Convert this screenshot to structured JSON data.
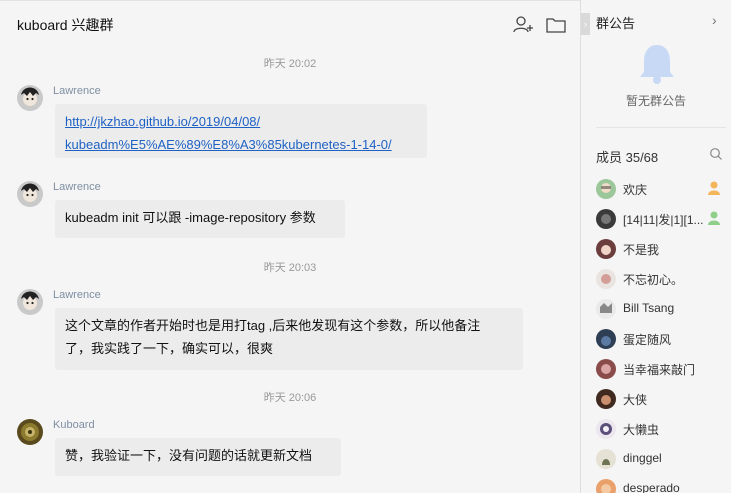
{
  "chat": {
    "title": "kuboard 兴趣群",
    "messages": [
      {
        "time": "昨天  20:02",
        "sender": "Lawrence",
        "link_line1": "http://jkzhao.github.io/2019/04/08/",
        "link_line2": "kubeadm%E5%AE%89%E8%A3%85kubernetes-1-14-0/"
      },
      {
        "sender": "Lawrence",
        "text": "kubeadm init 可以跟 -image-repository 参数"
      },
      {
        "time": "昨天  20:03",
        "sender": "Lawrence",
        "text_line1": "这个文章的作者开始时也是用打tag ,后来他发现有这个参数，所以他备注",
        "text_line2": "了，我实践了一下，确实可以，很爽"
      },
      {
        "time": "昨天  20:06",
        "sender": "Kuboard",
        "text": "赞，我验证一下，没有问题的话就更新文档"
      }
    ]
  },
  "sidebar": {
    "notice_title": "群公告",
    "notice_empty": "暂无群公告",
    "members_title": "成员 35/68",
    "members": [
      {
        "name": "欢庆",
        "owner": true
      },
      {
        "name": "[14|11|发|1][1...",
        "owner": true
      },
      {
        "name": "不是我"
      },
      {
        "name": "不忘初心。"
      },
      {
        "name": "Bill Tsang"
      },
      {
        "name": "蛋定随风"
      },
      {
        "name": "当幸福来敲门"
      },
      {
        "name": "大侠"
      },
      {
        "name": "大懒虫"
      },
      {
        "name": "dinggel"
      },
      {
        "name": "desperado"
      }
    ]
  }
}
